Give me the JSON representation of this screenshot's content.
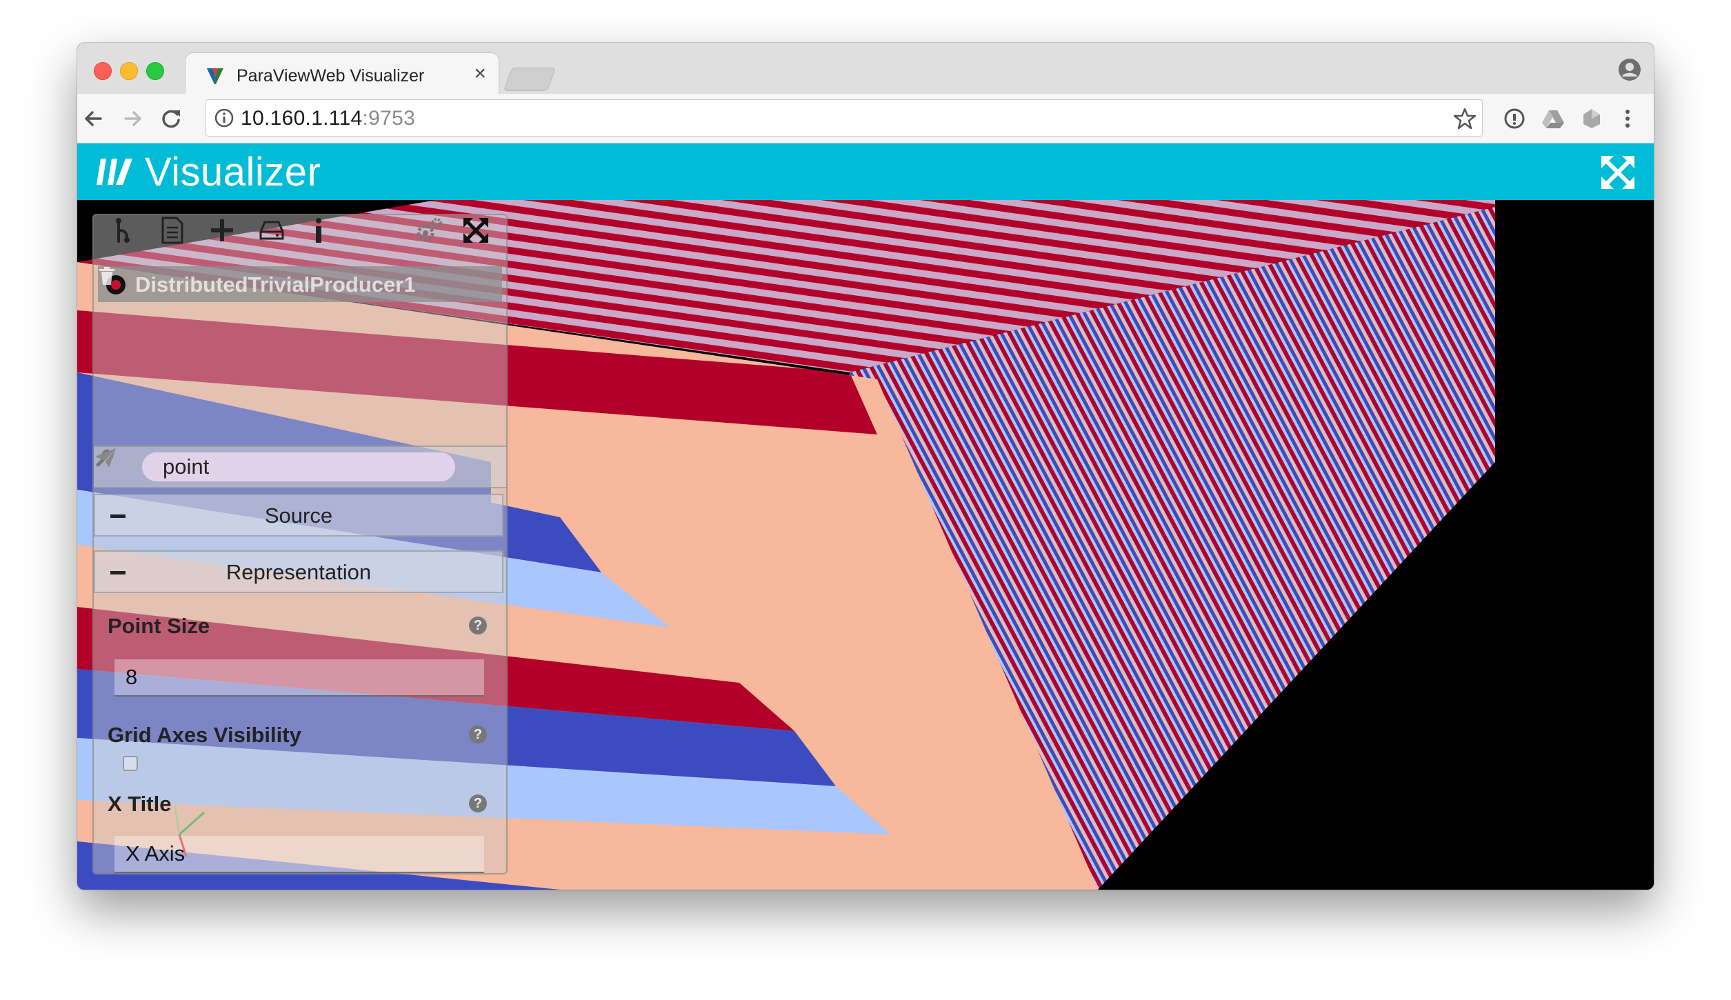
{
  "browser": {
    "tab_title": "ParaViewWeb Visualizer",
    "tab_close_glyph": "×",
    "url_host": "10.160.1.114",
    "url_port": ":9753",
    "icons": [
      "back-arrow-icon",
      "forward-arrow-icon",
      "reload-icon",
      "info-icon",
      "star-icon",
      "extension-icon",
      "drive-icon",
      "extension-icon",
      "menu-kebab-icon",
      "profile-icon"
    ]
  },
  "app": {
    "title": "Visualizer",
    "accent_color": "#00bcd6"
  },
  "panel": {
    "toolbar_icons": [
      "pipeline-icon",
      "file-icon",
      "add-icon",
      "storage-icon",
      "info-icon",
      "settings-gears-icon",
      "collapse-icon"
    ],
    "source_name": "DistributedTrivialProducer1",
    "search_value": "point",
    "sections": {
      "source_label": "Source",
      "representation_label": "Representation"
    },
    "properties": {
      "point_size_label": "Point Size",
      "point_size_value": "8",
      "grid_axes_label": "Grid Axes Visibility",
      "grid_axes_checked": false,
      "x_title_label": "X Title",
      "x_title_value": "X Axis",
      "help_glyph": "?"
    }
  },
  "render": {
    "colors": {
      "red": "#b2002a",
      "blue": "#3b4cc0",
      "light_blue": "#aac7fd",
      "salmon": "#f7b89c",
      "background": "#000000"
    }
  }
}
